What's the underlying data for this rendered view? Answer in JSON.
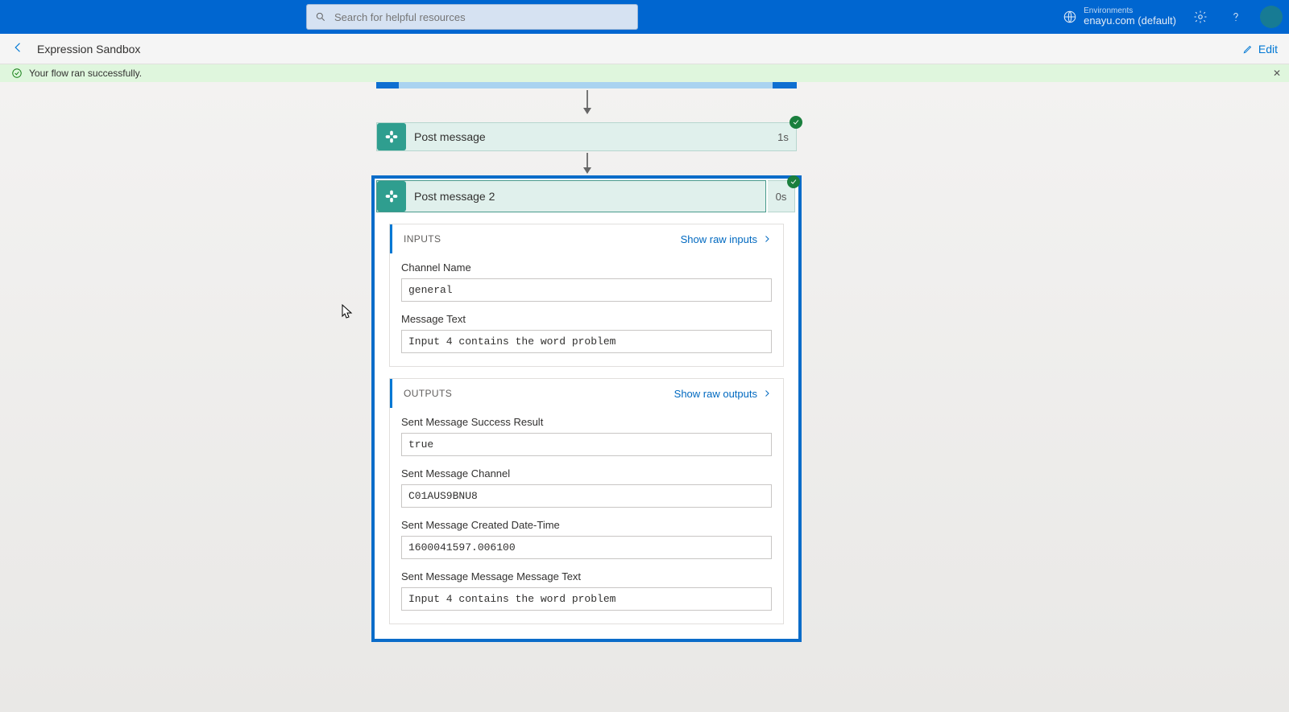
{
  "header": {
    "search_placeholder": "Search for helpful resources",
    "env_label": "Environments",
    "env_value": "enayu.com (default)"
  },
  "subheader": {
    "title": "Expression Sandbox",
    "edit_label": "Edit"
  },
  "banner": {
    "message": "Your flow ran successfully."
  },
  "flow": {
    "card1": {
      "title": "Post message",
      "duration": "1s"
    },
    "card2": {
      "title": "Post message 2",
      "duration": "0s",
      "inputs": {
        "section_title": "INPUTS",
        "show_raw_label": "Show raw inputs",
        "fields": [
          {
            "label": "Channel Name",
            "value": "general"
          },
          {
            "label": "Message Text",
            "value": "Input 4 contains the word problem"
          }
        ]
      },
      "outputs": {
        "section_title": "OUTPUTS",
        "show_raw_label": "Show raw outputs",
        "fields": [
          {
            "label": "Sent Message Success Result",
            "value": "true"
          },
          {
            "label": "Sent Message Channel",
            "value": "C01AUS9BNU8"
          },
          {
            "label": "Sent Message Created Date-Time",
            "value": "1600041597.006100"
          },
          {
            "label": "Sent Message Message Message Text",
            "value": "Input 4 contains the word problem"
          }
        ]
      }
    }
  }
}
